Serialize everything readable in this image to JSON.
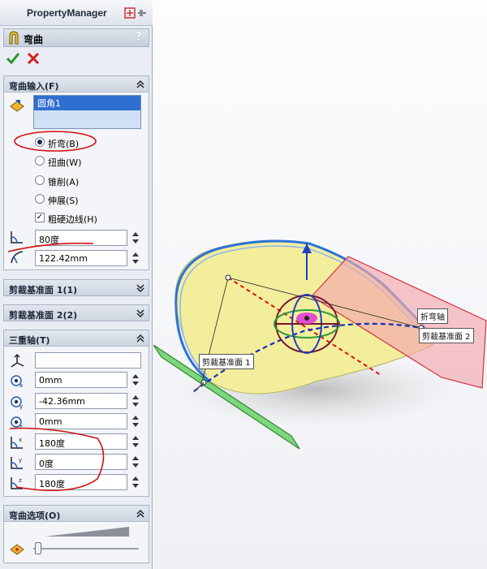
{
  "property_manager": {
    "title": "PropertyManager",
    "feature_name": "弯曲",
    "help": "?"
  },
  "flex_input": {
    "header": "弯曲输入(F)",
    "selection": "圆角1",
    "options": [
      {
        "label": "折弯(B)",
        "selected": true
      },
      {
        "label": "扭曲(W)",
        "selected": false
      },
      {
        "label": "锥削(A)",
        "selected": false
      },
      {
        "label": "伸展(S)",
        "selected": false
      }
    ],
    "hard_edges_label": "粗硬边线(H)",
    "angle": "80度",
    "radius": "122.42mm"
  },
  "trim_plane_1": {
    "header": "剪裁基准面 1(1)"
  },
  "trim_plane_2": {
    "header": "剪裁基准面 2(2)"
  },
  "triad": {
    "header": "三重轴(T)",
    "selection": "",
    "x": "0mm",
    "y": "-42.36mm",
    "z": "0mm",
    "rot_x": "180度",
    "rot_y": "0度",
    "rot_z": "180度"
  },
  "flex_options": {
    "header": "弯曲选项(O)"
  },
  "viewport": {
    "label_bend_axis": "折弯轴",
    "label_trim_plane_2": "剪裁基准面 2",
    "label_trim_plane_1": "剪裁基准面 1"
  },
  "colors": {
    "accent": "#c0c8d4",
    "annotation": "#d01010"
  },
  "icons": [
    "feature-flex-icon",
    "pin-icon",
    "help-icon",
    "ok-check-icon",
    "cancel-x-icon",
    "chevron-up-icon",
    "chevron-down-icon",
    "selection-icon",
    "angle-icon",
    "radius-icon",
    "triad-icon",
    "coord-x-icon",
    "coord-y-icon",
    "coord-z-icon",
    "rotation-x-icon",
    "rotation-y-icon",
    "rotation-z-icon",
    "accuracy-icon"
  ]
}
